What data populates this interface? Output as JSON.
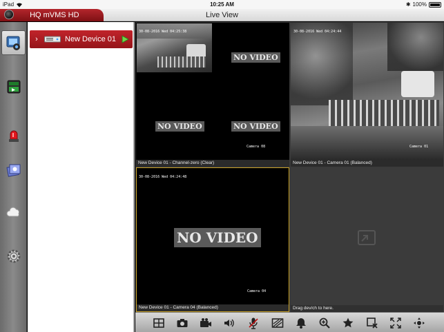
{
  "status_bar": {
    "device": "iPad",
    "time": "10:25 AM",
    "battery": "100%"
  },
  "app": {
    "name": "HQ mVMS HD",
    "page_title": "Live View"
  },
  "sidebar": {
    "items": [
      {
        "name": "live-view",
        "icon": "live-view-icon",
        "active": true
      },
      {
        "name": "playback",
        "icon": "playback-icon",
        "active": false
      },
      {
        "name": "alarm",
        "icon": "alarm-siren-icon",
        "active": false
      },
      {
        "name": "pictures",
        "icon": "pictures-icon",
        "active": false
      },
      {
        "name": "cloud",
        "icon": "cloud-icon",
        "active": false
      },
      {
        "name": "settings",
        "icon": "gear-icon",
        "active": false
      }
    ]
  },
  "devices": [
    {
      "name": "New Device 01",
      "expanded": false
    }
  ],
  "views": [
    {
      "caption": "New Device 01 - Channel-zero (Clear)",
      "timestamp": "30-08-2016 Wed 04:25:38",
      "camera_label": "Camera 08",
      "no_video_texts": [
        "NO VIDEO",
        "NO VIDEO",
        "NO VIDEO"
      ]
    },
    {
      "caption": "New Device 01 - Camera 01 (Balanced)",
      "timestamp": "30-08-2016 Wed 04:24:44",
      "camera_label": "Camera 01"
    },
    {
      "caption": "New Device 01 - Camera 04 (Balanced)",
      "timestamp": "30-08-2016 Wed 04:24:48",
      "camera_label": "Camera 04",
      "no_video_texts": [
        "NO VIDEO"
      ],
      "selected": true
    },
    {
      "caption": "Drag dev/ch to here.",
      "empty": true
    }
  ],
  "toolbar": {
    "buttons": [
      "layout-icon",
      "snapshot-icon",
      "record-icon",
      "audio-icon",
      "talk-icon",
      "quality-icon",
      "alarm-bell-icon",
      "zoom-icon",
      "favorite-icon",
      "stop-all-icon",
      "fullscreen-icon",
      "ptz-icon"
    ]
  },
  "colors": {
    "brand_red": "#a81c22",
    "selected_border": "#c9a227"
  }
}
